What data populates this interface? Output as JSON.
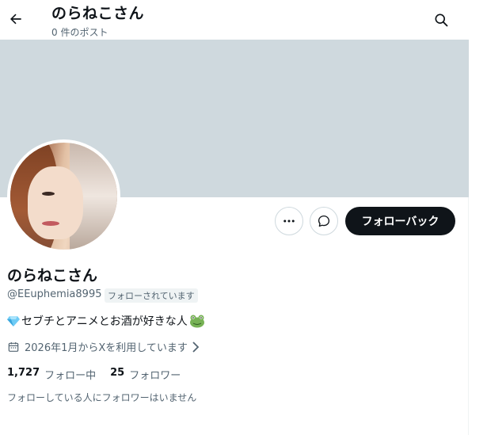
{
  "header": {
    "title": "のらねこさん",
    "post_count": "0 件のポスト"
  },
  "actions": {
    "follow_back_label": "フォローバック"
  },
  "profile": {
    "display_name": "のらねこさん",
    "handle": "@EEuphemia8995",
    "follows_you_badge": "フォローされています",
    "bio": "セブチとアニメとお酒が好きな人",
    "joined": "2026年1月からXを利用しています"
  },
  "stats": {
    "following_count": "1,727",
    "following_label": "フォロー中",
    "followers_count": "25",
    "followers_label": "フォロワー"
  },
  "known_followers": "フォローしている人にフォロワーはいません",
  "colors": {
    "banner": "#cfd9de",
    "primary_button": "#0f1419",
    "secondary_text": "#536471"
  }
}
